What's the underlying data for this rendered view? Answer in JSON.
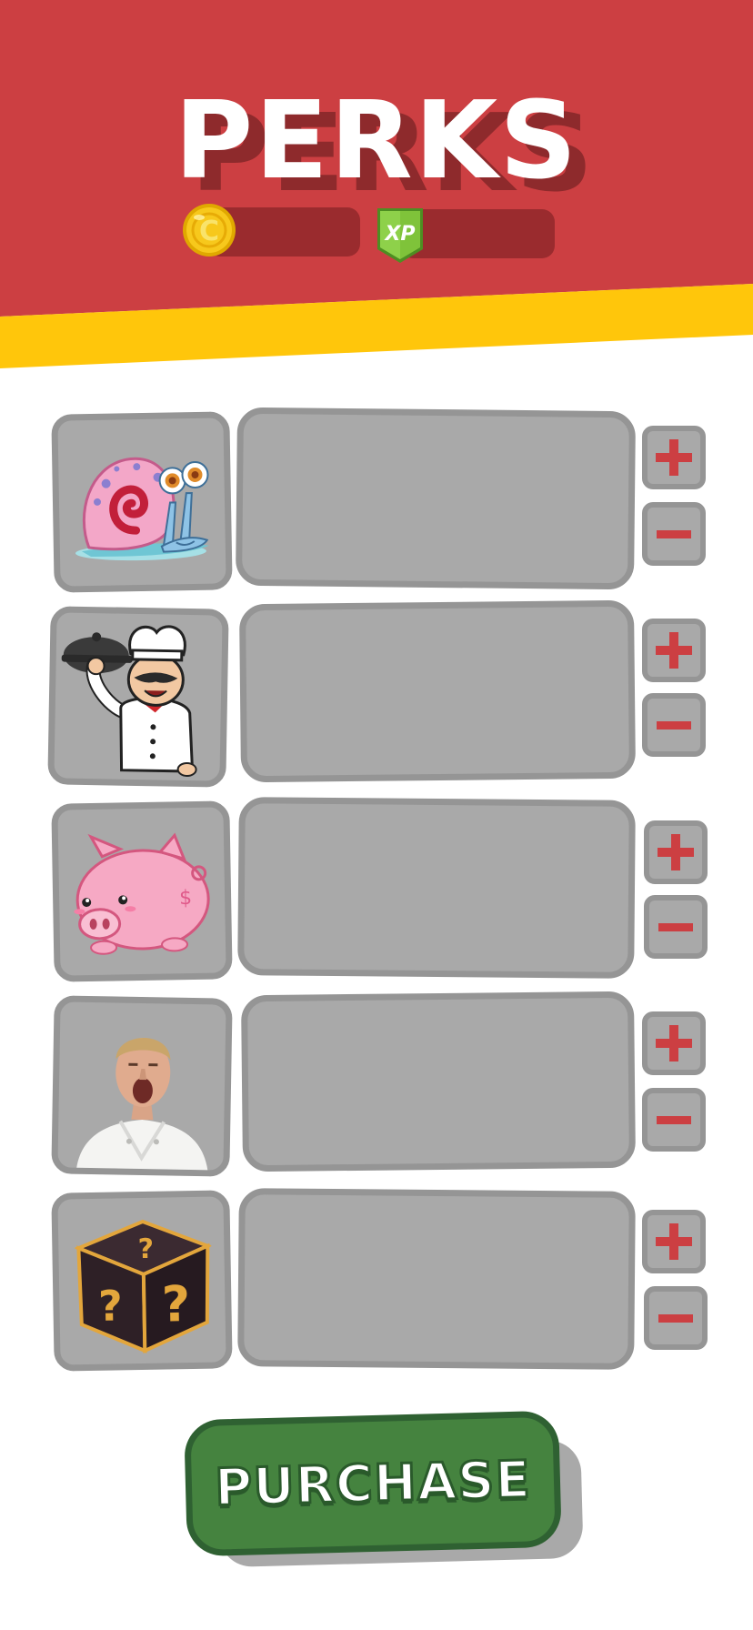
{
  "header": {
    "title": "PERKS",
    "colors": {
      "red": "#cc3f42",
      "yellow": "#ffc60b",
      "dark_red": "#9a2b2e"
    },
    "coin_icon": "coin-icon",
    "xp_icon": "xp-badge-icon",
    "xp_label": "XP",
    "coin_letter": "C"
  },
  "perks": [
    {
      "icon": "snail-icon",
      "description": ""
    },
    {
      "icon": "chef-waiter-icon",
      "description": ""
    },
    {
      "icon": "piggy-bank-icon",
      "description": ""
    },
    {
      "icon": "shouting-chef-photo",
      "description": ""
    },
    {
      "icon": "mystery-box-icon",
      "description": ""
    }
  ],
  "stepper": {
    "plus_icon": "plus-icon",
    "minus_icon": "minus-icon"
  },
  "purchase": {
    "label": "PURCHASE",
    "color": "#45833f"
  }
}
